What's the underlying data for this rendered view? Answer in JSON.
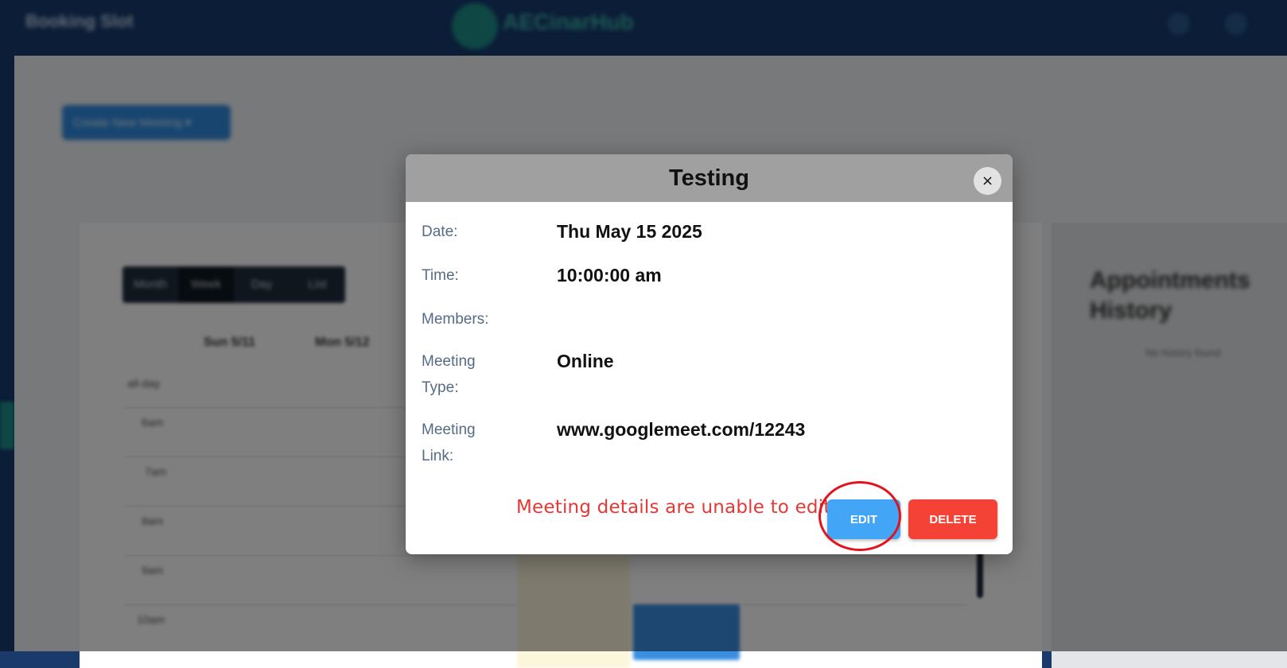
{
  "app": {
    "page_name": "Booking Slot",
    "brand": "AECinarHub"
  },
  "toolbar": {
    "create_button": "Create New Meeting ▾"
  },
  "calendar": {
    "views": [
      "Month",
      "Week",
      "Day",
      "List"
    ],
    "active_view": "Week",
    "columns": [
      "Sun 5/11",
      "Mon 5/12"
    ],
    "time_labels": [
      "all-day",
      "6am",
      "7am",
      "8am",
      "9am",
      "10am"
    ]
  },
  "history": {
    "title_line1": "Appointments",
    "title_line2": "History",
    "empty_text": "No history found"
  },
  "modal": {
    "title": "Testing",
    "close_symbol": "×",
    "fields": {
      "date_label": "Date:",
      "date_value": "Thu May 15 2025",
      "time_label": "Time:",
      "time_value": "10:00:00 am",
      "members_label": "Members:",
      "members_value": "",
      "meeting_type_label_line1": "Meeting",
      "meeting_type_label_line2": "Type:",
      "meeting_type_value": "Online",
      "meeting_link_label_line1": "Meeting",
      "meeting_link_label_line2": "Link:",
      "meeting_link_value": "www.googlemeet.com/12243"
    },
    "note": "Meeting details are unable to edit.",
    "edit_label": "EDIT",
    "delete_label": "DELETE"
  },
  "colors": {
    "header_bar": "#163a6e",
    "modal_header": "#a0a0a0",
    "edit_button": "#42a5f5",
    "delete_button": "#f44336",
    "annotation": "#e3121d"
  }
}
